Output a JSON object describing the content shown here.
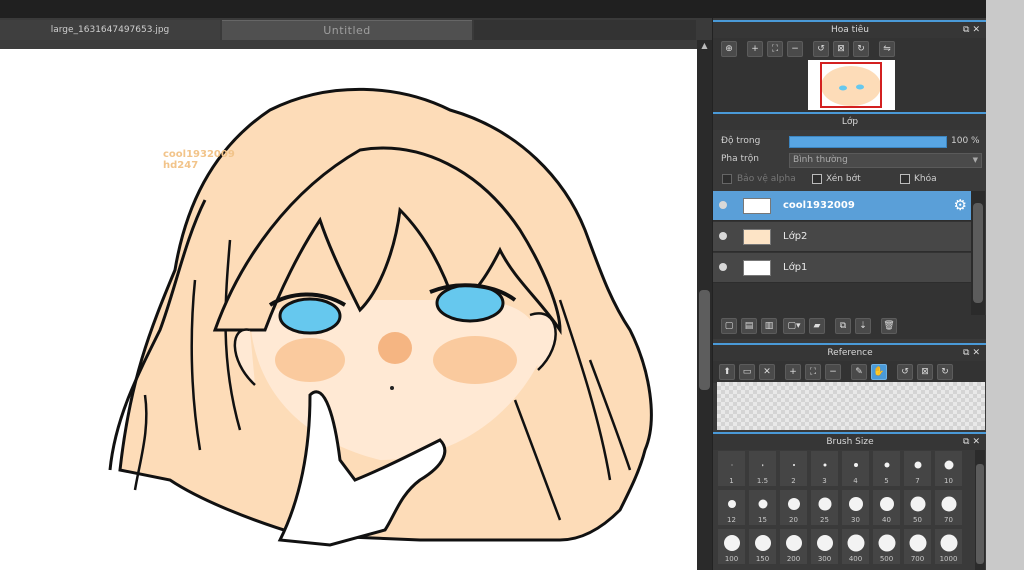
{
  "tabs": [
    {
      "label": "large_1631647497653.jpg"
    },
    {
      "label": "Untitled"
    }
  ],
  "watermark": {
    "line1": "cool1932009",
    "line2": "hd247"
  },
  "navigator": {
    "title": "Hoa tiêu"
  },
  "layer_panel": {
    "title": "Lớp",
    "opacity_label": "Độ trong",
    "opacity_value": "100 %",
    "opacity_fraction": 1.0,
    "blend_label": "Pha trộn",
    "blend_value": "Bình thường",
    "protect_alpha_label": "Bảo vệ alpha",
    "clipping_label": "Xén bớt",
    "lock_label": "Khóa",
    "layers": [
      {
        "name": "cool1932009",
        "selected": true
      },
      {
        "name": "Lớp2",
        "selected": false
      },
      {
        "name": "Lớp1",
        "selected": false
      }
    ]
  },
  "reference": {
    "title": "Reference"
  },
  "brush_size": {
    "title": "Brush Size",
    "sizes": [
      "1",
      "1.5",
      "2",
      "3",
      "4",
      "5",
      "7",
      "10",
      "12",
      "15",
      "20",
      "25",
      "30",
      "40",
      "50",
      "70",
      "100",
      "150",
      "200",
      "300",
      "400",
      "500",
      "700",
      "1000"
    ]
  },
  "colors": {
    "accent": "#4a9ad8",
    "selected_layer": "#5a9fd8",
    "hair": "#fddcb8",
    "eyes": "#66c8ee"
  }
}
